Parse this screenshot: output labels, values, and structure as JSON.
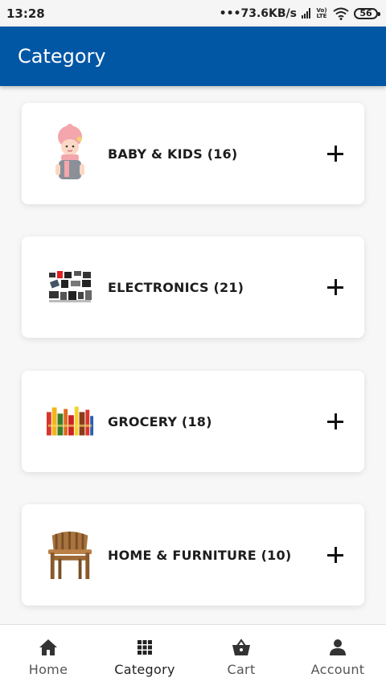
{
  "status_bar": {
    "time": "13:28",
    "net_speed": "•••73.6KB/s",
    "volte_top": "Vo)",
    "volte_bottom": "LTE",
    "battery": "56"
  },
  "app_bar": {
    "title": "Category",
    "color": "#0257a5"
  },
  "categories": [
    {
      "label": "BABY & KIDS (16)",
      "image": "baby-photo"
    },
    {
      "label": "ELECTRONICS (21)",
      "image": "electronics-photo"
    },
    {
      "label": "GROCERY (18)",
      "image": "grocery-photo"
    },
    {
      "label": "HOME & FURNITURE (10)",
      "image": "chair-photo"
    }
  ],
  "bottom_nav": {
    "items": [
      {
        "label": "Home",
        "icon": "home-icon"
      },
      {
        "label": "Category",
        "icon": "grid-icon",
        "active": true
      },
      {
        "label": "Cart",
        "icon": "basket-icon"
      },
      {
        "label": "Account",
        "icon": "person-icon"
      }
    ]
  }
}
